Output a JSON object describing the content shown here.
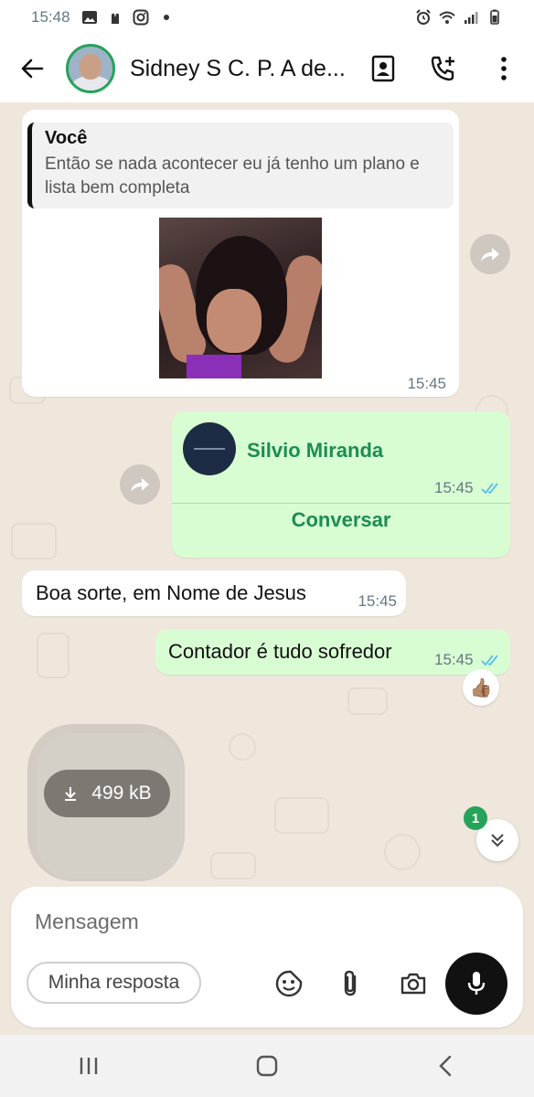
{
  "status_bar": {
    "time": "15:48",
    "icons": [
      "gallery-icon",
      "hands-icon",
      "instagram-icon",
      "dot-icon",
      "alarm-icon",
      "wifi-icon",
      "signal-icon",
      "battery-icon"
    ]
  },
  "header": {
    "contact_name": "Sidney S C. P. A de...",
    "actions": [
      "contact-card-icon",
      "add-call-icon",
      "more-options-icon"
    ]
  },
  "messages": [
    {
      "type": "image-reply",
      "direction": "in",
      "quote_author": "Você",
      "quote_text": "Então se nada acontecer eu já tenho   um plano e lista bem completa",
      "time": "15:45"
    },
    {
      "type": "contact",
      "direction": "out",
      "contact_name": "Silvio Miranda",
      "time": "15:45",
      "action_label": "Conversar"
    },
    {
      "type": "text",
      "direction": "in",
      "text": "Boa sorte, em Nome de Jesus",
      "time": "15:45"
    },
    {
      "type": "text",
      "direction": "out",
      "text": "Contador é tudo sofredor",
      "time": "15:45",
      "reaction": "👍🏽"
    },
    {
      "type": "file-download",
      "direction": "in",
      "size": "499 kB"
    }
  ],
  "unread_count": "1",
  "composer": {
    "placeholder": "Mensagem",
    "quick_reply_label": "Minha resposta"
  },
  "colors": {
    "accent": "#25a35a",
    "outgoing_bubble": "#d9fdd3",
    "chat_background": "#efe7dc",
    "read_ticks": "#53bdeb"
  }
}
